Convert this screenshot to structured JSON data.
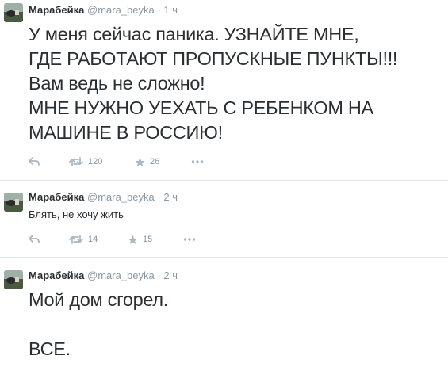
{
  "tweets": [
    {
      "author_name": "Марабейка",
      "handle": "@mara_beyka",
      "separator": "·",
      "time": "1 ч",
      "text": "У меня сейчас паника. УЗНАЙТЕ МНЕ,\nГДЕ РАБОТАЮТ ПРОПУСКНЫЕ ПУНКТЫ!!!\nВам ведь не сложно!\nМНЕ НУЖНО УЕХАТЬ С РЕБЕНКОМ НА\nМАШИНЕ В РОССИЮ!",
      "retweets": "120",
      "favorites": "26"
    },
    {
      "author_name": "Марабейка",
      "handle": "@mara_beyka",
      "separator": "·",
      "time": "2 ч",
      "text": "Блять, не хочу жить",
      "retweets": "14",
      "favorites": "15"
    },
    {
      "author_name": "Марабейка",
      "handle": "@mara_beyka",
      "separator": "·",
      "time": "2 ч",
      "text": "Мой дом сгорел.\n\nВСЕ."
    }
  ],
  "icons": {
    "reply": "reply-icon",
    "retweet": "retweet-icon",
    "favorite": "star-icon",
    "more": "more-dots-icon"
  },
  "colors": {
    "meta_gray": "#8899a6",
    "text": "#292f33",
    "divider": "#e1e8ed"
  }
}
